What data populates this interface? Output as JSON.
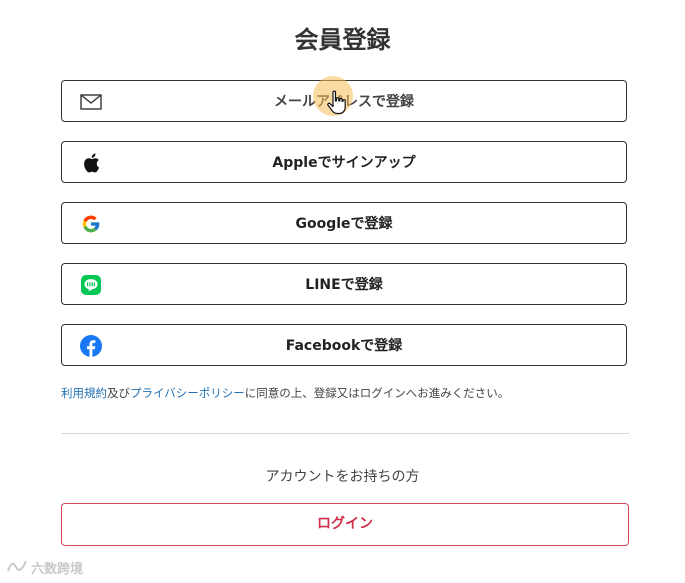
{
  "page": {
    "title": "会員登録"
  },
  "signup_options": [
    {
      "icon": "mail-icon",
      "label": "メールアドレスで登録"
    },
    {
      "icon": "apple-icon",
      "label": "Appleでサインアップ"
    },
    {
      "icon": "google-icon",
      "label": "Googleで登録"
    },
    {
      "icon": "line-icon",
      "label": "LINEで登録"
    },
    {
      "icon": "facebook-icon",
      "label": "Facebookで登録"
    }
  ],
  "terms": {
    "terms_link": "利用規約",
    "and": "及び",
    "privacy_link": "プライバシーポリシー",
    "rest": "に同意の上、登録又はログインへお進みください。"
  },
  "login": {
    "prompt": "アカウントをお持ちの方",
    "button_label": "ログイン"
  },
  "watermark": {
    "text": "六数跨境"
  },
  "colors": {
    "login_accent": "#d0304a",
    "link": "#1f6fb2",
    "line_green": "#06c755",
    "facebook_blue": "#1877f2"
  }
}
